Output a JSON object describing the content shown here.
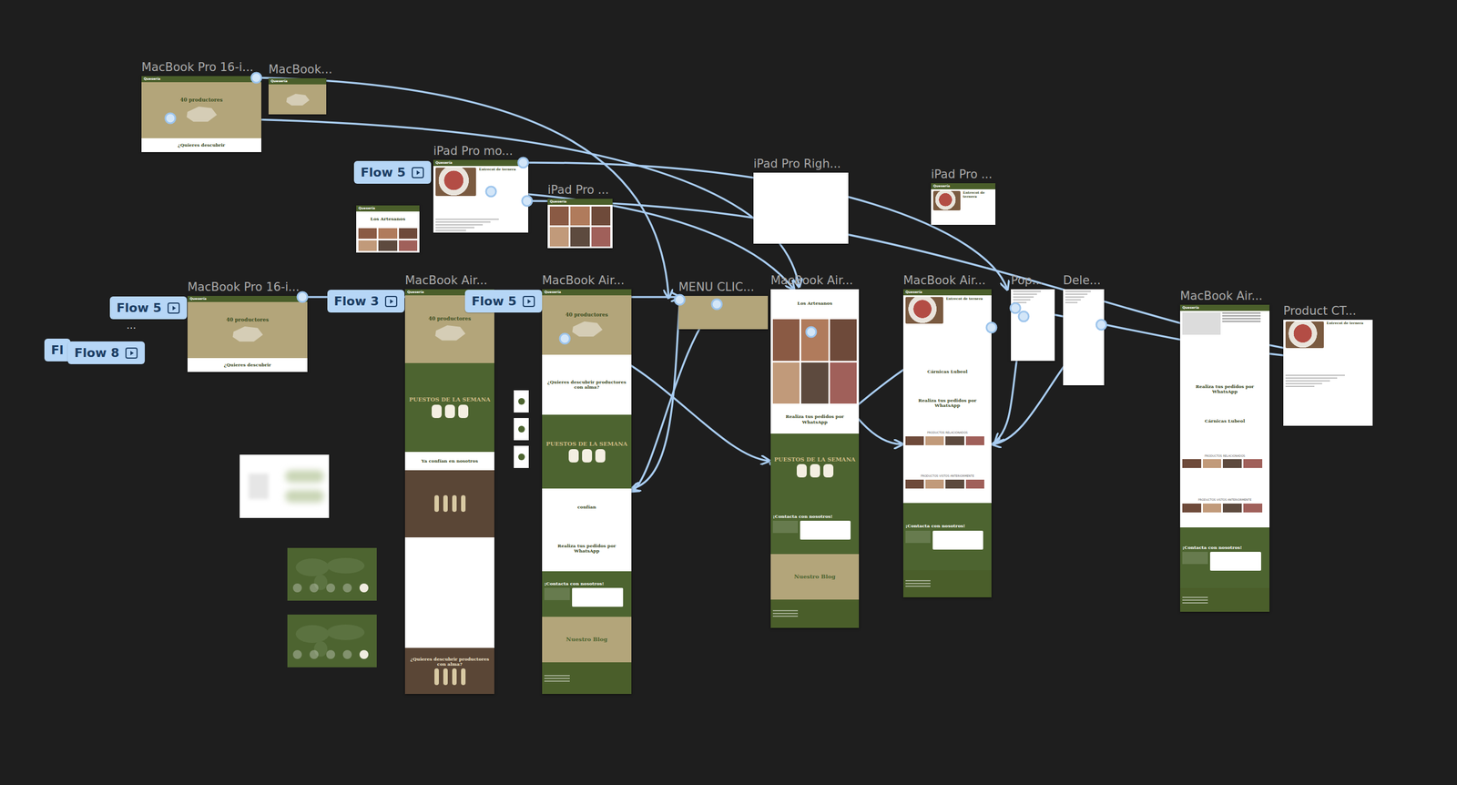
{
  "frames": [
    {
      "label": "MacBook Pro 16-i...",
      "sections": [
        {
          "kind": "nav",
          "text": "Quesería"
        },
        {
          "kind": "hero",
          "text": "40 productores"
        },
        {
          "kind": "white",
          "text": "¿Quieres descubrir"
        }
      ]
    },
    {
      "label": "MacBook...",
      "sections": [
        {
          "kind": "nav",
          "text": "Quesería"
        },
        {
          "kind": "hero"
        }
      ]
    },
    {
      "label": "iPad Pro mo...",
      "sections": [
        {
          "kind": "nav",
          "text": "Quesería"
        },
        {
          "kind": "product",
          "text": "Entrecot de ternera"
        },
        {
          "kind": "lines"
        }
      ]
    },
    {
      "sections": [
        {
          "kind": "nav",
          "text": "Quesería"
        },
        {
          "kind": "white",
          "text": "Los Artesanos"
        },
        {
          "kind": "photos"
        }
      ]
    },
    {
      "label": "iPad Pro ...",
      "sections": [
        {
          "kind": "nav",
          "text": "Quesería"
        },
        {
          "kind": "photos"
        }
      ]
    },
    {
      "label": "iPad Pro Righ...",
      "sections": [
        {
          "kind": "blank"
        }
      ]
    },
    {
      "label": "iPad Pro ...",
      "sections": [
        {
          "kind": "nav",
          "text": "Quesería"
        },
        {
          "kind": "product",
          "text": "Entrecot de ternera"
        }
      ]
    },
    {
      "label": "MacBook Pro 16-i...",
      "sections": [
        {
          "kind": "nav",
          "text": "Quesería"
        },
        {
          "kind": "hero",
          "text": "40 productores"
        },
        {
          "kind": "white",
          "text": "¿Quieres descubrir"
        }
      ]
    },
    {
      "label": "MacBook Air...",
      "sections": [
        {
          "kind": "nav",
          "text": "Quesería"
        },
        {
          "kind": "hero",
          "text": "40 productores"
        },
        {
          "kind": "green",
          "text": "PUESTOS DE LA SEMANA"
        },
        {
          "kind": "white",
          "text": "Ya confían en nosotros"
        },
        {
          "kind": "brown"
        },
        {
          "kind": "blank"
        },
        {
          "kind": "brown",
          "text": "¿Quieres descubrir productores con alma?"
        }
      ]
    },
    {
      "label": "MacBook Air...",
      "sections": [
        {
          "kind": "nav",
          "text": "Quesería"
        },
        {
          "kind": "hero",
          "text": "40 productores"
        },
        {
          "kind": "white",
          "text": "¿Quieres descubrir productores con alma?"
        },
        {
          "kind": "green",
          "text": "PUESTOS DE LA SEMANA"
        },
        {
          "kind": "white",
          "text": "confían"
        },
        {
          "kind": "white",
          "text": "Realiza tus pedidos por WhatsApp"
        },
        {
          "kind": "form",
          "text": "¡Contacta con nosotros!"
        },
        {
          "kind": "olive",
          "text": "Nuestro Blog"
        },
        {
          "kind": "footer"
        }
      ]
    },
    {
      "label": "MENU CLIC...",
      "sections": [
        {
          "kind": "olive"
        }
      ]
    },
    {
      "label": "MacBook Air...",
      "sections": [
        {
          "kind": "white",
          "text": "Los Artesanos"
        },
        {
          "kind": "photos"
        },
        {
          "kind": "white",
          "text": "Realiza tus pedidos por WhatsApp"
        },
        {
          "kind": "green",
          "text": "PUESTOS DE LA SEMANA"
        },
        {
          "kind": "form",
          "text": "¡Contacta con nosotros!"
        },
        {
          "kind": "olive",
          "text": "Nuestro Blog"
        },
        {
          "kind": "footer"
        }
      ]
    },
    {
      "label": "MacBook Air...",
      "sections": [
        {
          "kind": "nav",
          "text": "Quesería"
        },
        {
          "kind": "product",
          "text": "Entrecot de ternera"
        },
        {
          "kind": "white",
          "text": "Cárnicas Lubeol"
        },
        {
          "kind": "white",
          "text": "Realiza tus pedidos por WhatsApp"
        },
        {
          "kind": "products",
          "text": "PRODUCTOS RELACIONADOS"
        },
        {
          "kind": "products",
          "text": "PRODUCTOS VISTOS ANTERIORMENTE"
        },
        {
          "kind": "form",
          "text": "¡Contacta con nosotros!"
        },
        {
          "kind": "footer"
        }
      ]
    },
    {
      "label": "Pop...",
      "sections": [
        {
          "kind": "lines"
        }
      ]
    },
    {
      "label": "Dele...",
      "sections": [
        {
          "kind": "lines"
        }
      ]
    },
    {
      "label": "MacBook Air...",
      "sections": [
        {
          "kind": "nav",
          "text": "Quesería"
        },
        {
          "kind": "formpanel"
        },
        {
          "kind": "white",
          "text": "Realiza tus pedidos por WhatsApp"
        },
        {
          "kind": "white",
          "text": "Cárnicas Lubeol"
        },
        {
          "kind": "products",
          "text": "PRODUCTOS RELACIONADOS"
        },
        {
          "kind": "products",
          "text": "PRODUCTOS VISTOS ANTERIORMENTE"
        },
        {
          "kind": "form",
          "text": "¡Contacta con nosotros!"
        },
        {
          "kind": "footer"
        }
      ]
    },
    {
      "label": "Product CT...",
      "sections": [
        {
          "kind": "product",
          "text": "Entrecot de ternera"
        },
        {
          "kind": "lines"
        }
      ]
    }
  ],
  "flows": [
    {
      "label": "Flow 5"
    },
    {
      "label": "Flow 5"
    },
    {
      "label": "Fl"
    },
    {
      "label": "Flow 8"
    },
    {
      "label": "Flow 3"
    },
    {
      "label": "Flow 5"
    }
  ],
  "overflow_mark": "···"
}
